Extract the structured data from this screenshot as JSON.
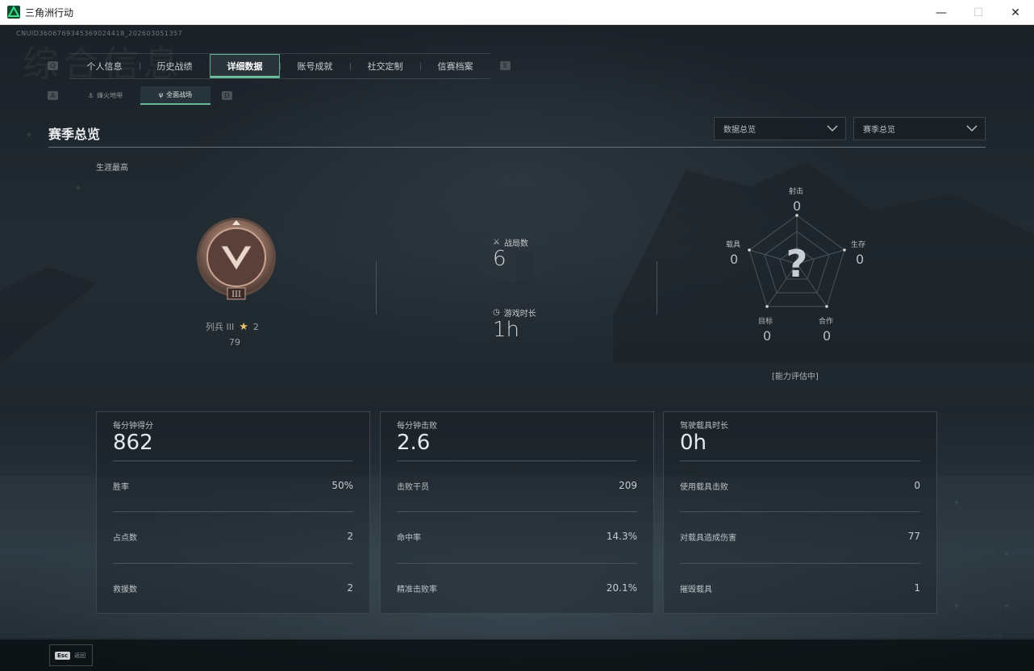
{
  "window": {
    "title": "三角洲行动",
    "minimize": "—",
    "maximize": "☐",
    "close": "✕"
  },
  "uid": "CNUID3606769345369024418_202603051357",
  "watermark": "综合信息",
  "key_hints": {
    "main_left": "Q",
    "main_right": "E",
    "sub_left": "A",
    "sub_right": "D"
  },
  "main_tabs": [
    "个人信息",
    "历史战绩",
    "详细数据",
    "账号成就",
    "社交定制",
    "信赛档案"
  ],
  "active_main_tab": 2,
  "sub_tabs": [
    {
      "label": "烽火地带",
      "icon": "anchor-icon"
    },
    {
      "label": "全面战场",
      "icon": "trident-icon"
    }
  ],
  "active_sub_tab": 1,
  "section": {
    "title": "赛季总览",
    "dropdowns": [
      "数据总览",
      "赛季总览"
    ],
    "career_label": "生涯最高"
  },
  "rank": {
    "name": "列兵 III",
    "stars": "2",
    "score": "79",
    "badge_numeral": "III"
  },
  "stats": {
    "matches_label": "战局数",
    "matches_value": "6",
    "playtime_label": "游戏时长",
    "playtime_value": "1h"
  },
  "radar": {
    "center": "?",
    "status": "[能力评估中]",
    "axes": [
      {
        "label": "射击",
        "value": "0"
      },
      {
        "label": "生存",
        "value": "0"
      },
      {
        "label": "合作",
        "value": "0"
      },
      {
        "label": "目标",
        "value": "0"
      },
      {
        "label": "载具",
        "value": "0"
      }
    ]
  },
  "cards": [
    {
      "label": "每分钟得分",
      "value": "862",
      "rows": [
        {
          "label": "胜率",
          "value": "50%"
        },
        {
          "label": "占点数",
          "value": "2"
        },
        {
          "label": "救援数",
          "value": "2"
        }
      ]
    },
    {
      "label": "每分钟击败",
      "value": "2.6",
      "rows": [
        {
          "label": "击败干员",
          "value": "209"
        },
        {
          "label": "命中率",
          "value": "14.3%"
        },
        {
          "label": "精准击败率",
          "value": "20.1%"
        }
      ]
    },
    {
      "label": "驾驶载具时长",
      "value": "0h",
      "rows": [
        {
          "label": "使用载具击败",
          "value": "0"
        },
        {
          "label": "对载具造成伤害",
          "value": "77"
        },
        {
          "label": "摧毁载具",
          "value": "1"
        }
      ]
    }
  ],
  "bottom": {
    "esc_key": "Esc",
    "esc_label": "返回"
  },
  "colors": {
    "accent": "#67b995",
    "background": "#1f272e",
    "text": "#c9ced2"
  }
}
